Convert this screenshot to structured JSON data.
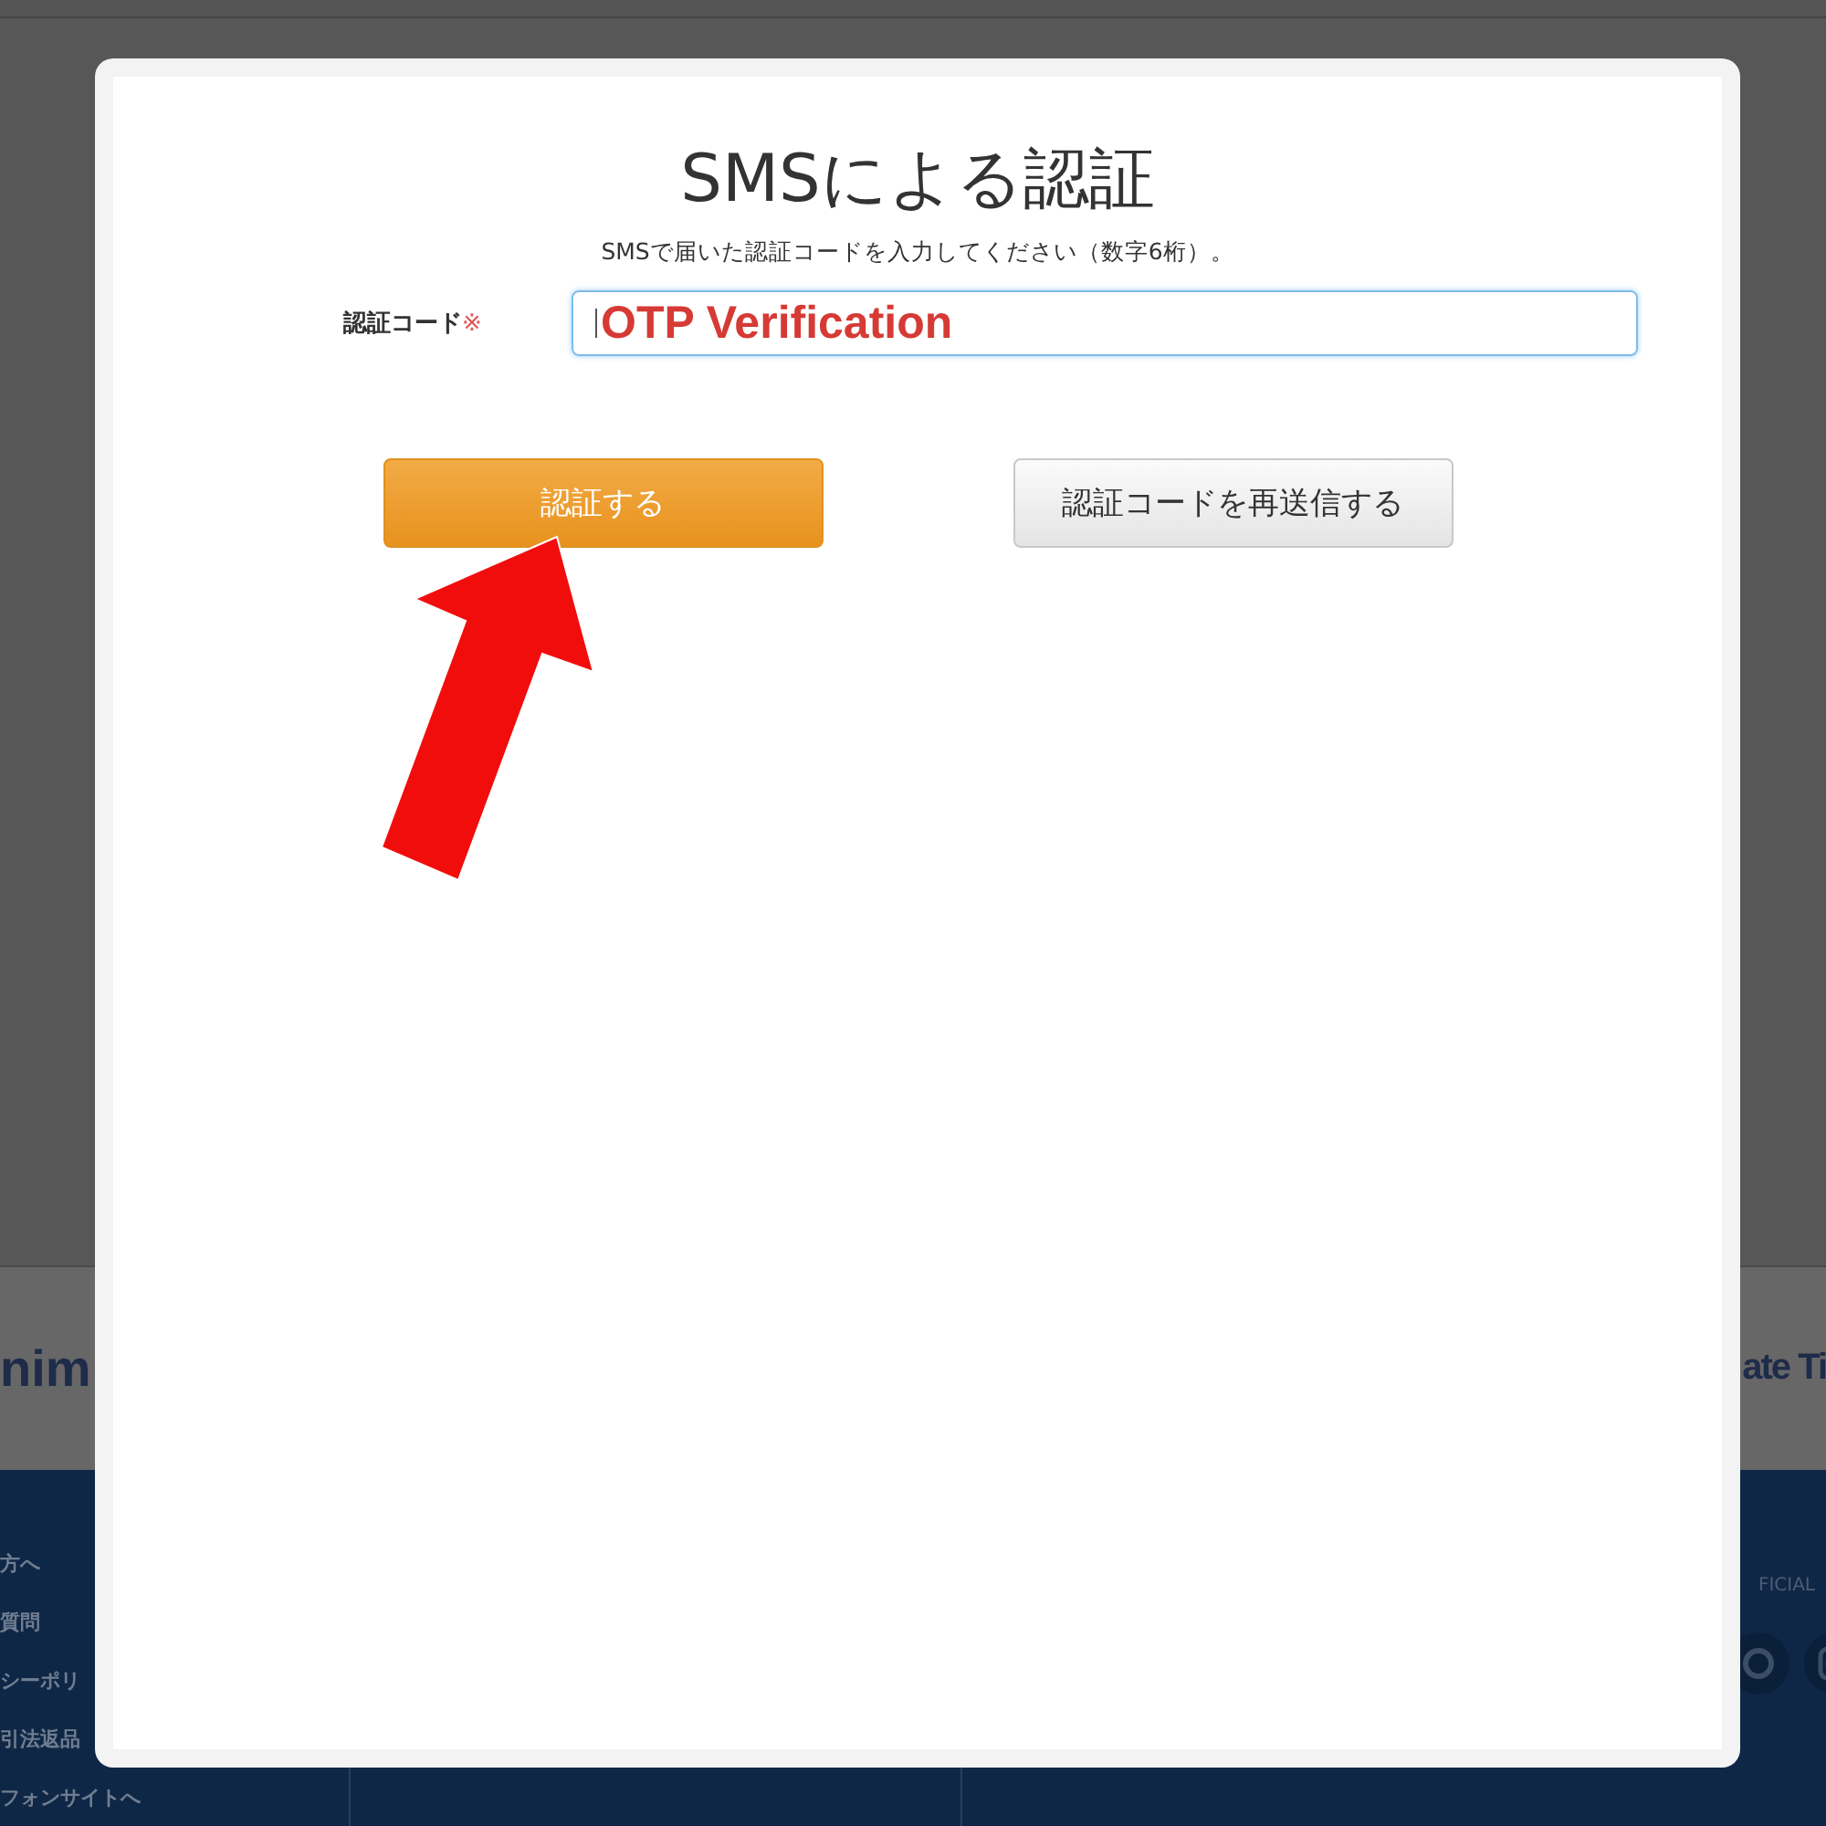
{
  "background": {
    "logos": [
      "nim",
      "ate Ti"
    ],
    "footer_links": [
      "方へ",
      "質問",
      "シーポリ",
      "引法返品",
      "フォンサイトへ"
    ],
    "social_heading": "FICIAL"
  },
  "dialog": {
    "title": "SMSによる認証",
    "instruction": "SMSで届いた認証コードを入力してください（数字6桁）。",
    "field": {
      "label": "認証コード",
      "required_mark": "※",
      "value": "OTP Verification"
    },
    "buttons": [
      {
        "label": "認証する",
        "kind": "primary"
      },
      {
        "label": "認証コードを再送信する",
        "kind": "secondary"
      }
    ]
  }
}
